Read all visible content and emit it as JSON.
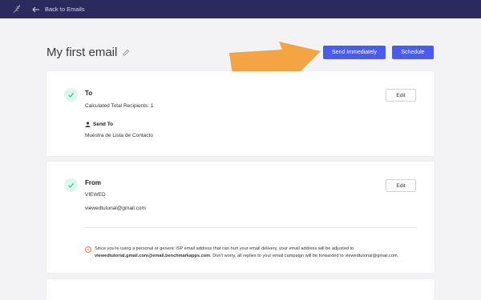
{
  "header": {
    "back_label": "Back to Emails",
    "background": "#2b2a5e"
  },
  "page": {
    "title": "My first email"
  },
  "actions": {
    "send_label": "Send Immediately",
    "schedule_label": "Schedule",
    "primary_color": "#4a5cf0",
    "callout_color": "#f5a443"
  },
  "to_section": {
    "heading": "To",
    "recipients_text": "Calculated Total Recipients: 1",
    "send_to_label": "Send To",
    "list_name": "Muestra de Lista de Contacto",
    "edit_label": "Edit"
  },
  "from_section": {
    "heading": "From",
    "from_name": "VIEWED",
    "from_email": "viewedtutorial@gmail.com",
    "edit_label": "Edit",
    "warning": {
      "part1": "Since you're using a personal or generic ISP email address that can hurt your email delivery, your email address will be adjusted to",
      "adjusted_email": "viewedtutorial.gmail.com@email.benchmarkapps.com",
      "part2": ". Don't worry, all replies to your email campaign will be forwarded to viewedtutorial@gmail.com."
    }
  },
  "icons": {
    "logo": "feather-logo-icon",
    "back": "arrow-left-icon",
    "pencil": "pencil-icon",
    "check": "check-circle-icon",
    "person": "person-icon",
    "warning": "minus-circle-icon"
  },
  "colors": {
    "check_bg": "#dcf7ee",
    "check_mark": "#2bc48f",
    "warning": "#e5683a"
  }
}
